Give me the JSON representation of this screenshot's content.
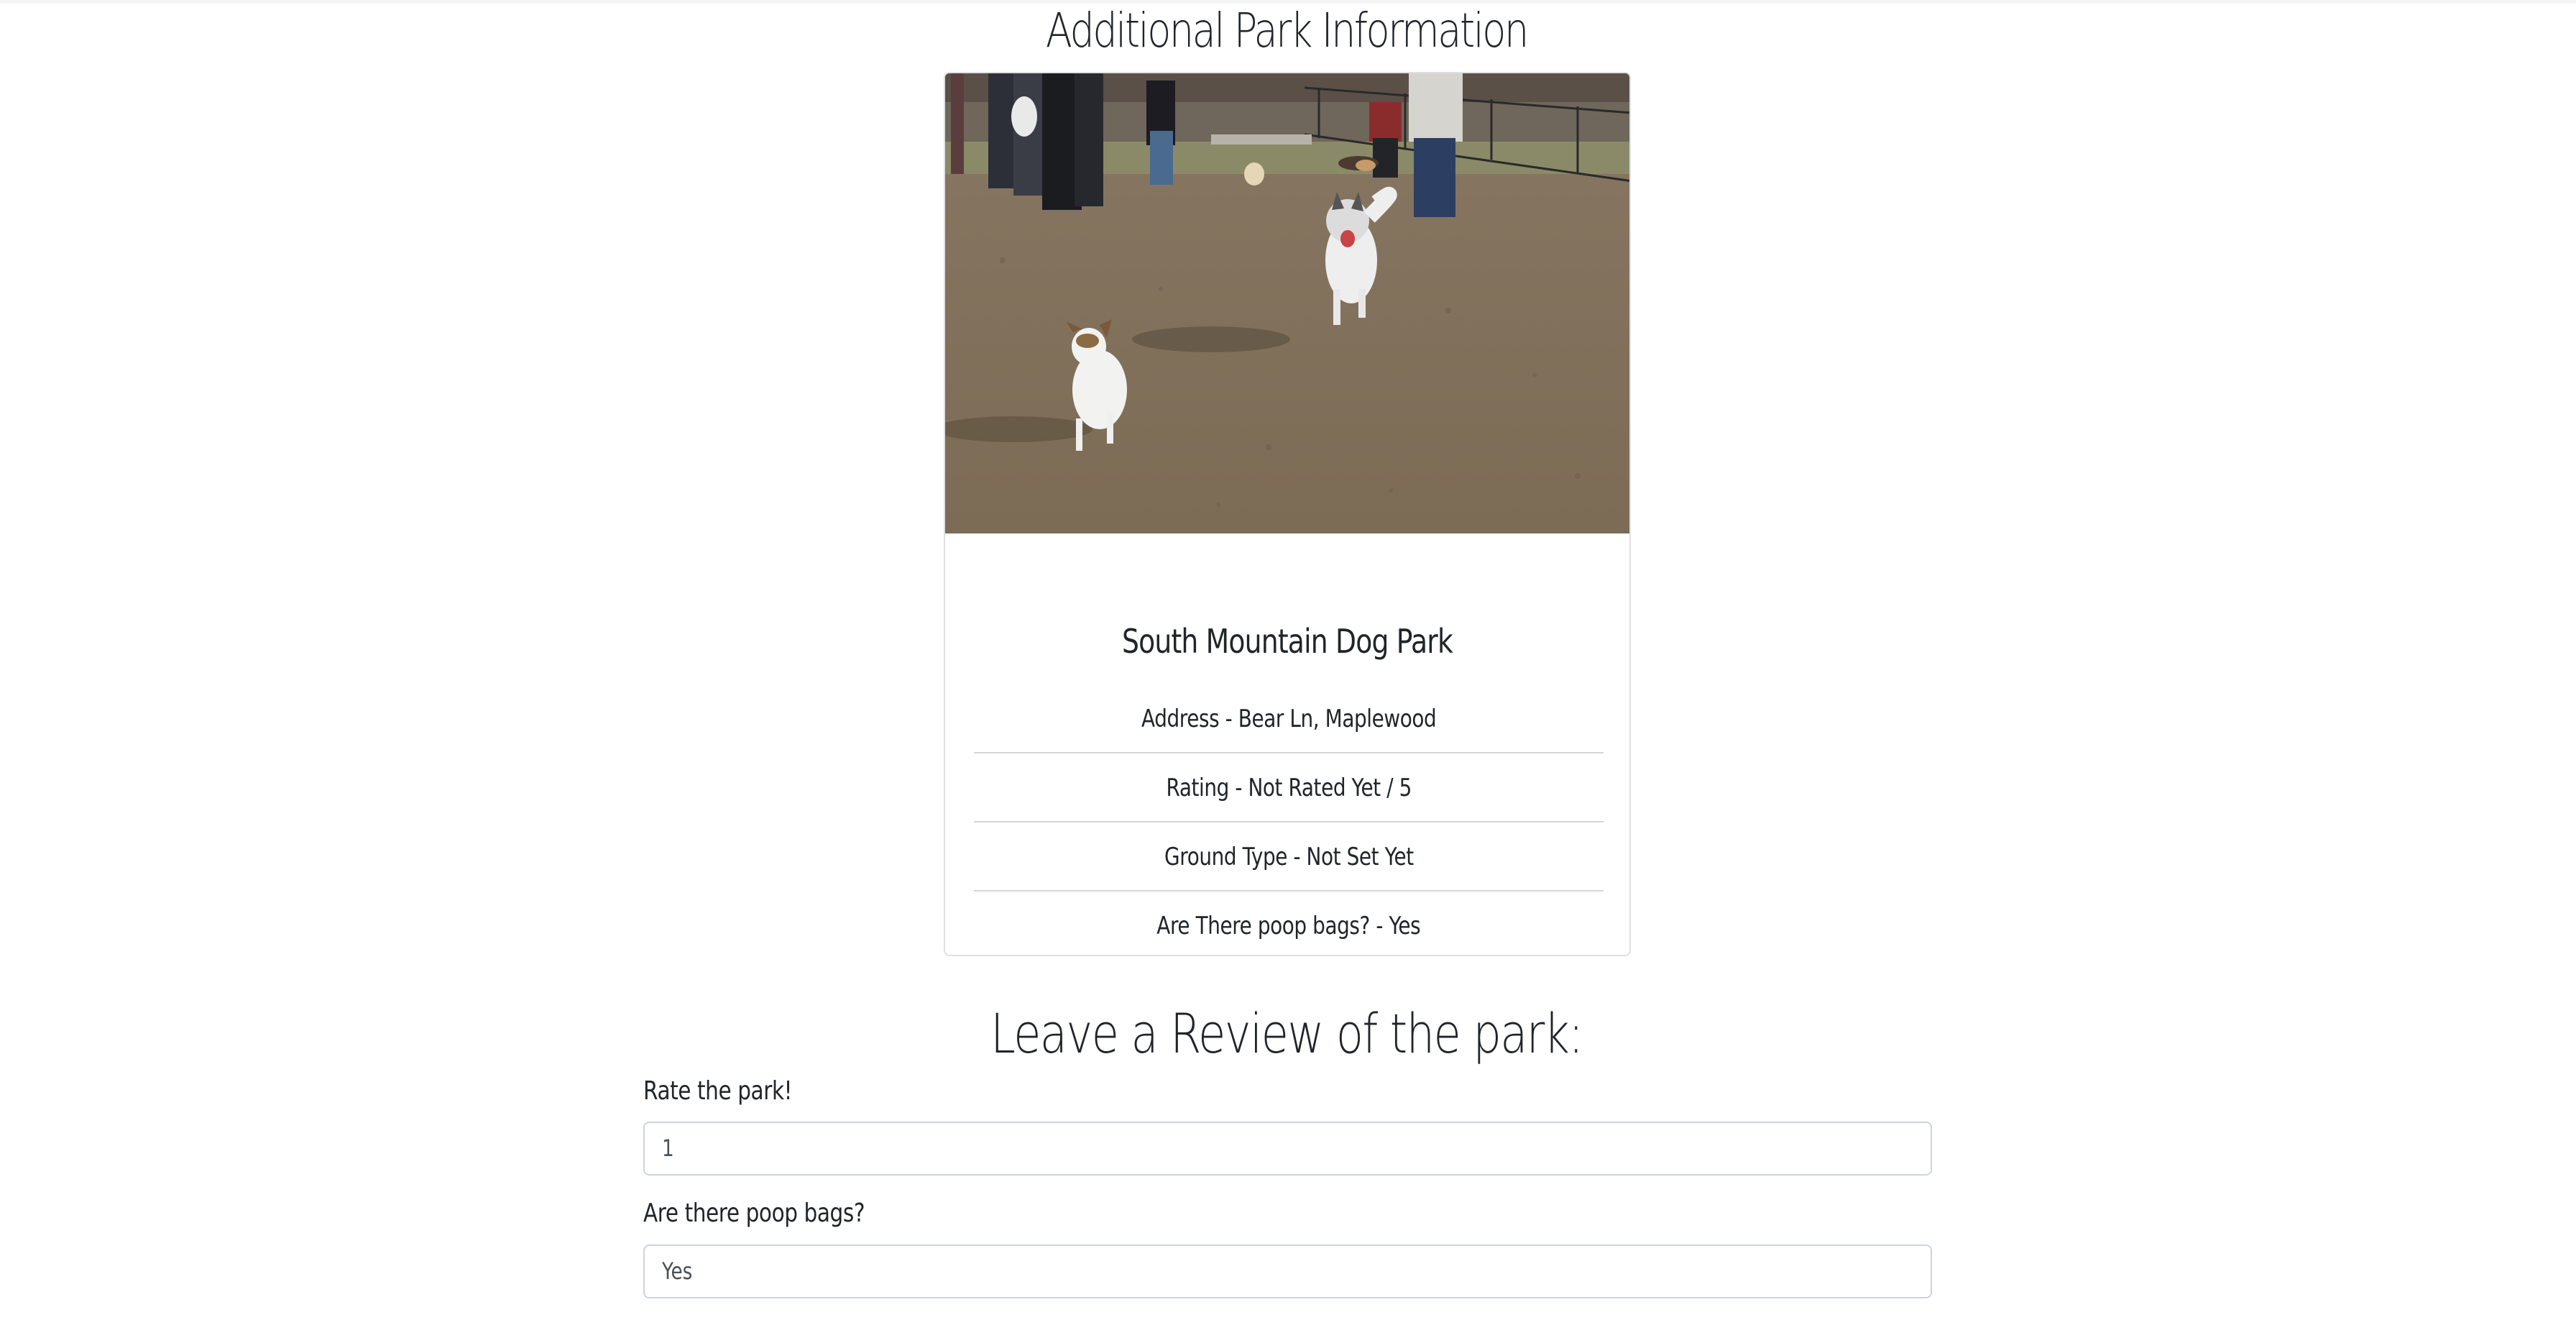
{
  "page_title": "Additional Park Information",
  "park": {
    "name": "South Mountain Dog Park",
    "details": [
      "Address - Bear Ln, Maplewood",
      "Rating - Not Rated Yet / 5",
      "Ground Type - Not Set Yet",
      "Are There poop bags? - Yes"
    ]
  },
  "review": {
    "heading": "Leave a Review of the park:",
    "rate_label": "Rate the park!",
    "rate_value": "1",
    "poop_label": "Are there poop bags?",
    "poop_value": "Yes"
  },
  "colors": {
    "text": "#212529",
    "border": "#ced4da",
    "divider": "#d6d6d6",
    "ground": "#8a7a62"
  }
}
